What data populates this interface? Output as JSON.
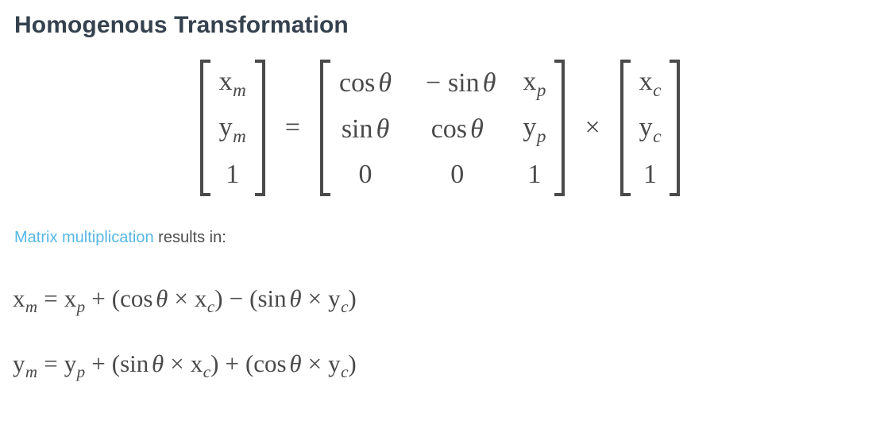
{
  "page": {
    "title": "Homogenous Transformation",
    "background_color": "#ffffff",
    "heading_color": "#35414e",
    "body_text_color": "#4d4d4d",
    "math_color": "#4a4a4a",
    "link_color": "#57b7e6"
  },
  "matrix_equation": {
    "result_vector": {
      "rows": [
        "x_m",
        "y_m",
        "1"
      ],
      "cells": [
        {
          "base": "x",
          "sub": "m"
        },
        {
          "base": "y",
          "sub": "m"
        },
        {
          "base": "1",
          "sub": ""
        }
      ]
    },
    "equals_sign": "=",
    "transform_matrix": {
      "rows": [
        [
          "cos θ",
          "− sin θ",
          "x_p"
        ],
        [
          "sin θ",
          "cos θ",
          "y_p"
        ],
        [
          "0",
          "0",
          "1"
        ]
      ],
      "cells": {
        "r1c1_func": "cos",
        "r1c1_arg": "θ",
        "r1c2_sign": "−",
        "r1c2_func": "sin",
        "r1c2_arg": "θ",
        "r1c3_base": "x",
        "r1c3_sub": "p",
        "r2c1_func": "sin",
        "r2c1_arg": "θ",
        "r2c2_func": "cos",
        "r2c2_arg": "θ",
        "r2c3_base": "y",
        "r2c3_sub": "p",
        "r3c1": "0",
        "r3c2": "0",
        "r3c3": "1"
      }
    },
    "times_sign": "×",
    "input_vector": {
      "rows": [
        "x_c",
        "y_c",
        "1"
      ],
      "cells": [
        {
          "base": "x",
          "sub": "c"
        },
        {
          "base": "y",
          "sub": "c"
        },
        {
          "base": "1",
          "sub": ""
        }
      ]
    }
  },
  "lead_line": {
    "link_text": "Matrix multiplication",
    "rest_text": " results in:"
  },
  "result_equations": [
    {
      "id": "x-equation",
      "plain": "x_m = x_p + (cos θ × x_c) − (sin θ × y_c)",
      "lhs_base": "x",
      "lhs_sub": "m",
      "equals": "=",
      "t1_base": "x",
      "t1_sub": "p",
      "op1": "+",
      "open1": "(",
      "f1": "cos",
      "f1_arg": "θ",
      "times1": "×",
      "v1_base": "x",
      "v1_sub": "c",
      "close1": ")",
      "op2": "−",
      "open2": "(",
      "f2": "sin",
      "f2_arg": "θ",
      "times2": "×",
      "v2_base": "y",
      "v2_sub": "c",
      "close2": ")"
    },
    {
      "id": "y-equation",
      "plain": "y_m = y_p + (sin θ × x_c) + (cos θ × y_c)",
      "lhs_base": "y",
      "lhs_sub": "m",
      "equals": "=",
      "t1_base": "y",
      "t1_sub": "p",
      "op1": "+",
      "open1": "(",
      "f1": "sin",
      "f1_arg": "θ",
      "times1": "×",
      "v1_base": "x",
      "v1_sub": "c",
      "close1": ")",
      "op2": "+",
      "open2": "(",
      "f2": "cos",
      "f2_arg": "θ",
      "times2": "×",
      "v2_base": "y",
      "v2_sub": "c",
      "close2": ")"
    }
  ]
}
